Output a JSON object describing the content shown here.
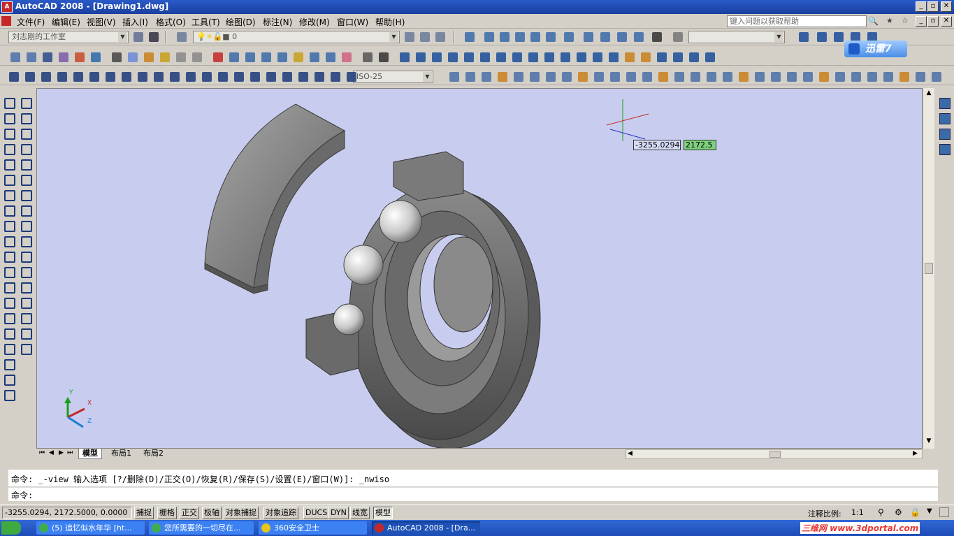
{
  "app": {
    "logo": "A",
    "title": "AutoCAD 2008 - [Drawing1.dwg]",
    "window_controls": [
      "_",
      "▫",
      "✕"
    ],
    "doc_controls": [
      "_",
      "▫",
      "✕"
    ]
  },
  "menu": {
    "items": [
      "文件(F)",
      "编辑(E)",
      "视图(V)",
      "插入(I)",
      "格式(O)",
      "工具(T)",
      "绘图(D)",
      "标注(N)",
      "修改(M)",
      "窗口(W)",
      "帮助(H)"
    ],
    "help_placeholder": "键入问题以获取帮助"
  },
  "toolbars": {
    "workspace": "刘志刚的工作室",
    "layer_value": "0",
    "dim_style": "ISO-25",
    "xunlei_badge": "迅雷7"
  },
  "drawing": {
    "dyn_x": "-3255.0294",
    "dyn_y": "2172.5",
    "ucs": {
      "x": "X",
      "y": "Y",
      "z": "Z"
    }
  },
  "tabs": {
    "nav": [
      "⏮",
      "◀",
      "▶",
      "⏭"
    ],
    "items": [
      "模型",
      "布局1",
      "布局2"
    ]
  },
  "command": {
    "history": "命令: _-view 输入选项 [?/删除(D)/正交(O)/恢复(R)/保存(S)/设置(E)/窗口(W)]: _nwiso",
    "prompt": "命令:"
  },
  "status": {
    "coords": "-3255.0294, 2172.5000, 0.0000",
    "toggles": [
      "捕捉",
      "栅格",
      "正交",
      "极轴",
      "对象捕捉",
      "对象追踪",
      "DUCS",
      "DYN",
      "线宽",
      "模型"
    ],
    "annotation_scale_label": "注释比例:",
    "annotation_scale": "1:1"
  },
  "taskbar": {
    "tasks": [
      {
        "label": "(5) 追忆似水年华 [ht...",
        "color": "#3fae49"
      },
      {
        "label": "您所需要的一切尽在...",
        "color": "#3fae49"
      },
      {
        "label": "360安全卫士",
        "color": "#e6c619"
      },
      {
        "label": "AutoCAD 2008 - [Dra...",
        "color": "#c62828"
      }
    ],
    "watermark": "三维网 www.3dportal.com"
  }
}
